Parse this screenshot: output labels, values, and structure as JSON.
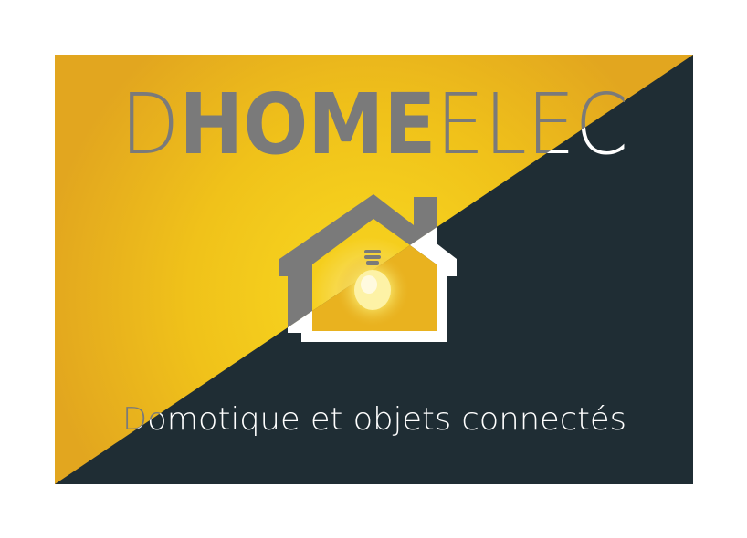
{
  "logo": {
    "brand_part_1": "D",
    "brand_part_2": "HOME",
    "brand_part_3": "ELEC",
    "tagline": "Domotique et objets connectés",
    "icon": "house-with-lightbulb-icon"
  },
  "colors": {
    "yellow": "#f3c614",
    "yellow_dark": "#e2a61f",
    "dark_slate": "#1f2d34",
    "grey": "#7a7a7a",
    "white": "#ffffff"
  }
}
